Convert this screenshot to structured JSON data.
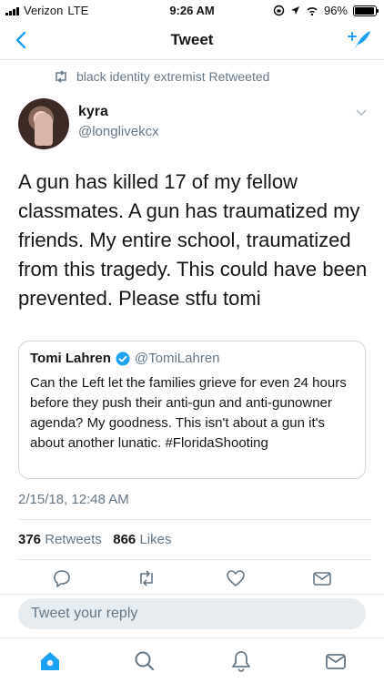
{
  "status_bar": {
    "carrier": "Verizon",
    "network": "LTE",
    "time": "9:26 AM",
    "battery_percent": "96%",
    "battery_level": 0.96
  },
  "nav": {
    "title": "Tweet",
    "back_icon": "chevron-left-icon",
    "compose_icon": "compose-tweet-icon"
  },
  "colors": {
    "accent": "#1da1f2",
    "secondary_text": "#657786",
    "divider": "#e1e8ed"
  },
  "retweet_context": {
    "icon": "retweet-icon",
    "text": "black identity extremist Retweeted"
  },
  "tweet": {
    "display_name": "kyra",
    "handle": "@longlivekcx",
    "text": "A gun has killed 17 of my fellow classmates. A gun has traumatized my friends. My entire school, traumatized from this tragedy. This could have been prevented. Please stfu tomi",
    "timestamp": "2/15/18, 12:48 AM",
    "retweets": "376",
    "retweets_label": "Retweets",
    "likes": "866",
    "likes_label": "Likes"
  },
  "quoted_tweet": {
    "display_name": "Tomi Lahren",
    "verified_icon": "verified-badge-icon",
    "handle": "@TomiLahren",
    "text": "Can the Left let the families grieve for even 24 hours before they push their anti-gun and anti-gunowner agenda? My goodness. This isn't about a gun it's about another lunatic. #FloridaShooting"
  },
  "actions": [
    "reply-icon",
    "retweet-icon",
    "like-icon",
    "share-icon"
  ],
  "reply": {
    "placeholder": "Tweet your reply"
  },
  "tabbar": [
    "home-icon",
    "search-icon",
    "notifications-icon",
    "messages-icon"
  ]
}
